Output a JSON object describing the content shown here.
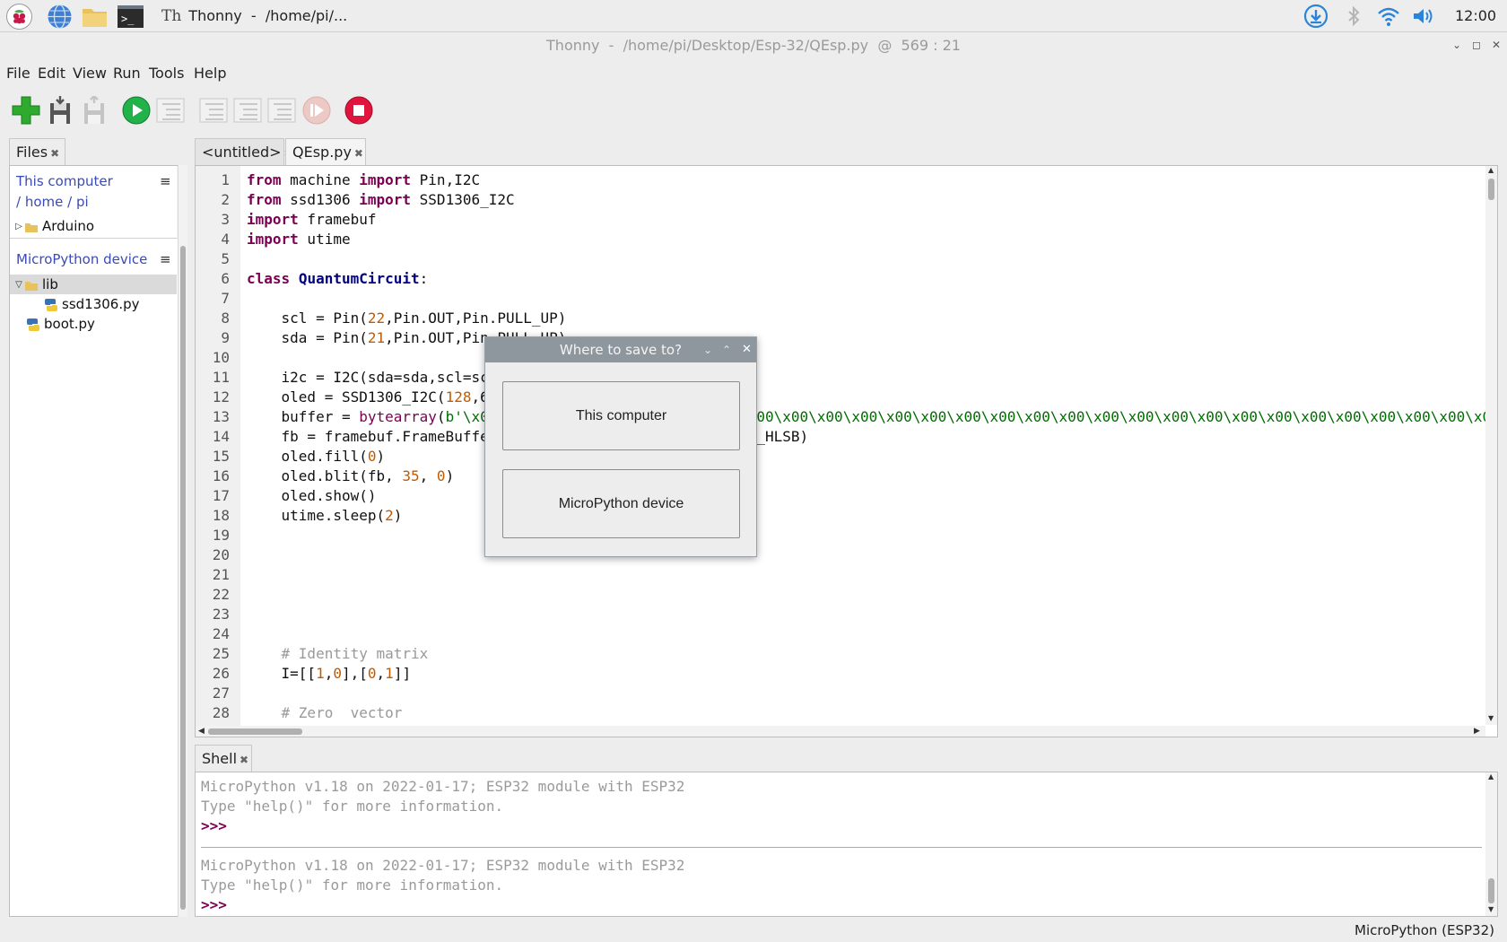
{
  "taskbar": {
    "window_label": "Thonny  -  /home/pi/...",
    "clock": "12:00",
    "icons": [
      "raspberry-menu-icon",
      "web-browser-icon",
      "file-manager-icon",
      "terminal-icon"
    ],
    "tray": [
      "download-icon",
      "bluetooth-icon",
      "wifi-icon",
      "volume-icon"
    ]
  },
  "window": {
    "title": "Thonny  -  /home/pi/Desktop/Esp-32/QEsp.py  @  569 : 21"
  },
  "menu": [
    "File",
    "Edit",
    "View",
    "Run",
    "Tools",
    "Help"
  ],
  "toolbar": [
    "new-file",
    "load-file",
    "save-file",
    "run",
    "debug",
    "step-over",
    "step-into",
    "step-out",
    "resume",
    "stop"
  ],
  "files": {
    "tab_label": "Files",
    "computer_header": "This computer",
    "path_sep1": "/",
    "path_home": "home",
    "path_sep2": "/",
    "path_pi": "pi",
    "computer_items": [
      "Arduino"
    ],
    "device_header": "MicroPython device",
    "device_items": [
      "lib",
      "ssd1306.py",
      "boot.py"
    ]
  },
  "editor": {
    "tabs": [
      "<untitled>",
      "QEsp.py"
    ],
    "line_numbers": [
      "1",
      "2",
      "3",
      "4",
      "5",
      "6",
      "7",
      "8",
      "9",
      "10",
      "11",
      "12",
      "13",
      "14",
      "15",
      "16",
      "17",
      "18",
      "19",
      "20",
      "21",
      "22",
      "23",
      "24",
      "25",
      "26",
      "27",
      "28"
    ],
    "lines": {
      "l1": [
        "from",
        " machine ",
        "import",
        " Pin,I2C"
      ],
      "l2": [
        "from",
        " ssd1306 ",
        "import",
        " SSD1306_I2C"
      ],
      "l3": [
        "import",
        " framebuf"
      ],
      "l4": [
        "import",
        " utime"
      ],
      "l6": [
        "class",
        " ",
        "QuantumCircuit",
        ":"
      ],
      "l8": [
        "    scl = Pin(",
        "22",
        ",Pin.OUT,Pin.PULL_UP)"
      ],
      "l9": [
        "    sda = Pin(",
        "21",
        ",Pin.OUT,Pin.PULL_UP)"
      ],
      "l11": "    i2c = I2C(sda=sda,scl=scl",
      "l12": [
        "    oled = SSD1306_I2C(",
        "128",
        ",64,i2c)"
      ],
      "l13": [
        "    buffer = ",
        "bytearray",
        "(",
        "b'\\x00\\x00\\x00\\x00\\x00\\x00\\x00\\x00\\x00\\x00\\x00\\x00\\x00\\x00\\x00\\x00\\x00\\x00\\x00\\x00\\x00\\x00\\x00\\x00\\x00\\x00\\x00\\x00\\x00\\x00\\x00\\x00\\x00\\x00\\x00\\x00\\x00"
      ],
      "l14": "    fb = framebuf.FrameBuffer(buffer, 64, 64, framebuf.MONO_HLSB)",
      "l15": [
        "    oled.fill(",
        "0",
        ")"
      ],
      "l16": [
        "    oled.blit(fb, ",
        "35",
        ", ",
        "0",
        ")"
      ],
      "l17": "    oled.show()",
      "l18": [
        "    utime.sleep(",
        "2",
        ")"
      ],
      "l25": "    # Identity matrix",
      "l26": [
        "    I=[[",
        "1",
        ",",
        "0",
        "],[",
        "0",
        ",",
        "1",
        "]]"
      ],
      "l28": "    # Zero  vector"
    }
  },
  "shell": {
    "tab_label": "Shell",
    "banner1": "MicroPython v1.18 on 2022-01-17; ESP32 module with ESP32",
    "help1": "Type \"help()\" for more information.",
    "prompt1": ">>>",
    "banner2": "MicroPython v1.18 on 2022-01-17; ESP32 module with ESP32",
    "help2": "Type \"help()\" for more information.",
    "prompt2": ">>>"
  },
  "status": "MicroPython (ESP32)",
  "dialog": {
    "title": "Where to save to?",
    "option1": "This computer",
    "option2": "MicroPython device"
  }
}
